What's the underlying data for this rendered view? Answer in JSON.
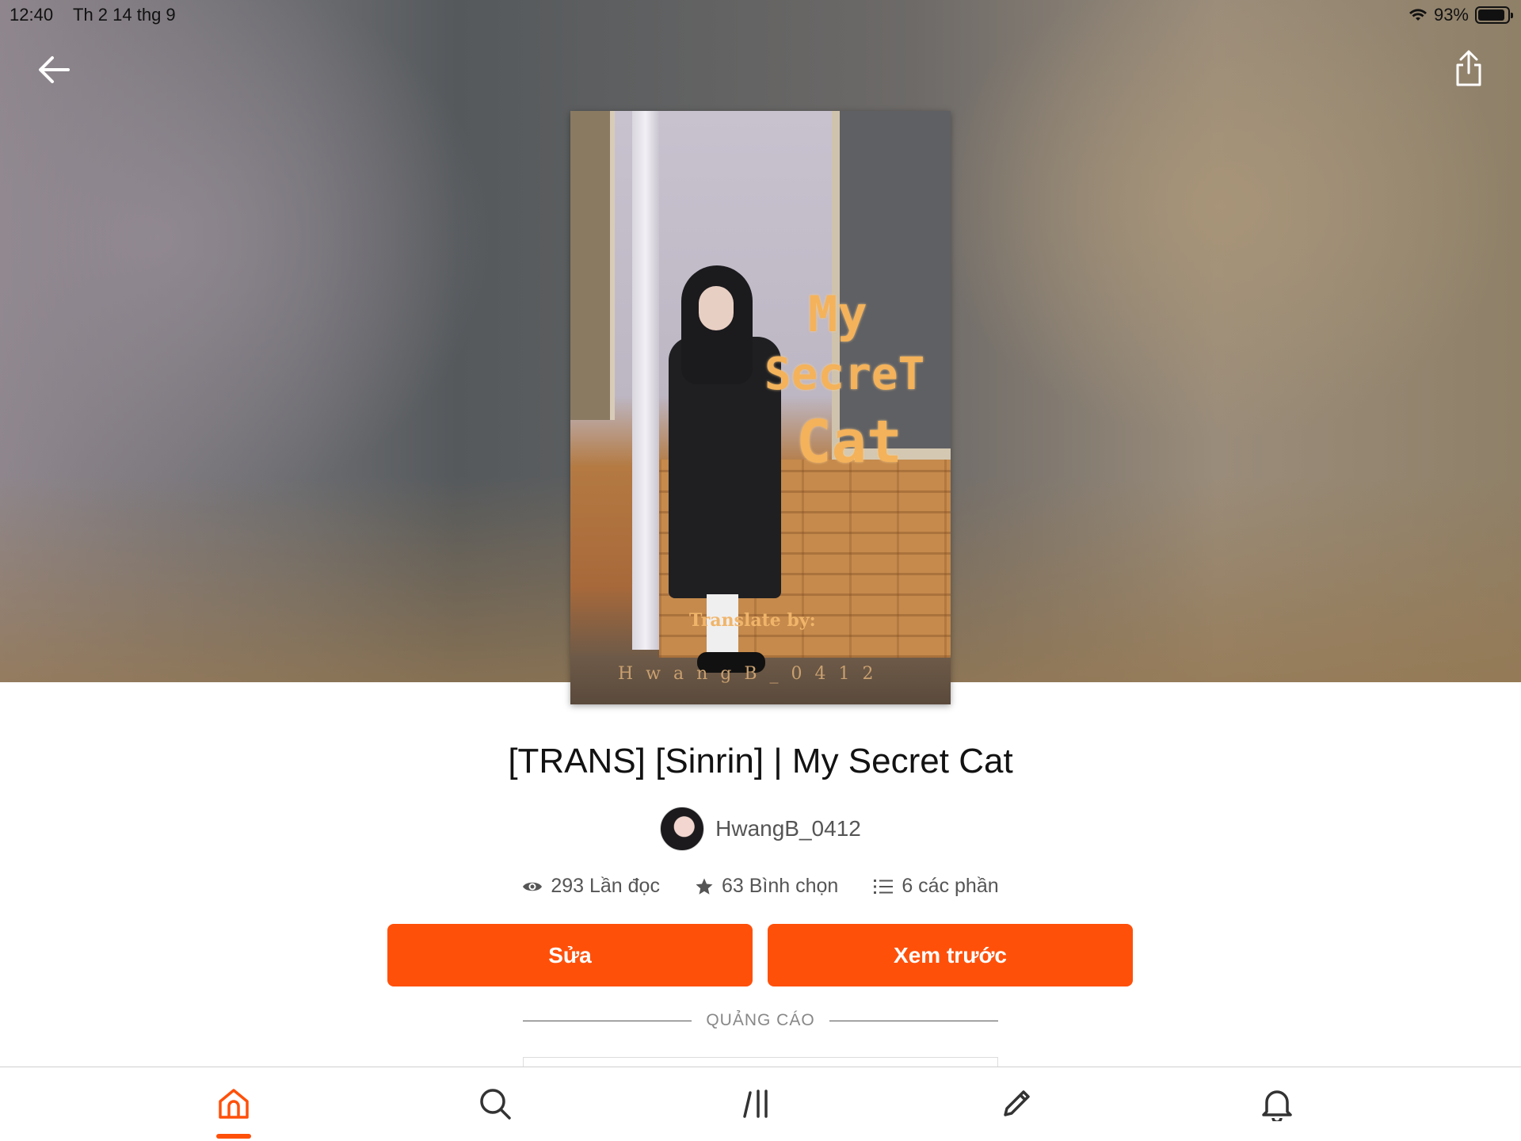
{
  "status_bar": {
    "time": "12:40",
    "date": "Th 2 14 thg 9",
    "battery_text": "93%",
    "battery_level": 0.93
  },
  "header": {
    "back_icon": "arrow-left-icon",
    "share_icon": "share-icon"
  },
  "cover": {
    "title_line1": "My",
    "title_line2": "SecreT",
    "title_line3": "Cat",
    "credit": "Translate by:",
    "author_watermark": "HwangB_0412"
  },
  "story": {
    "title": "[TRANS] [Sinrin] | My Secret Cat",
    "author": "HwangB_0412"
  },
  "stats": {
    "reads": "293 Lần đọc",
    "votes": "63 Bình chọn",
    "parts": "6 các phần"
  },
  "actions": {
    "edit_label": "Sửa",
    "preview_label": "Xem trước"
  },
  "ad": {
    "label": "QUẢNG CÁO"
  },
  "tabs": [
    {
      "icon": "home-icon",
      "active": true
    },
    {
      "icon": "search-icon",
      "active": false
    },
    {
      "icon": "library-icon",
      "active": false
    },
    {
      "icon": "pencil-icon",
      "active": false
    },
    {
      "icon": "bell-icon",
      "active": false
    }
  ],
  "colors": {
    "accent": "#ff500a",
    "text_primary": "#121212",
    "text_secondary": "#555555"
  }
}
